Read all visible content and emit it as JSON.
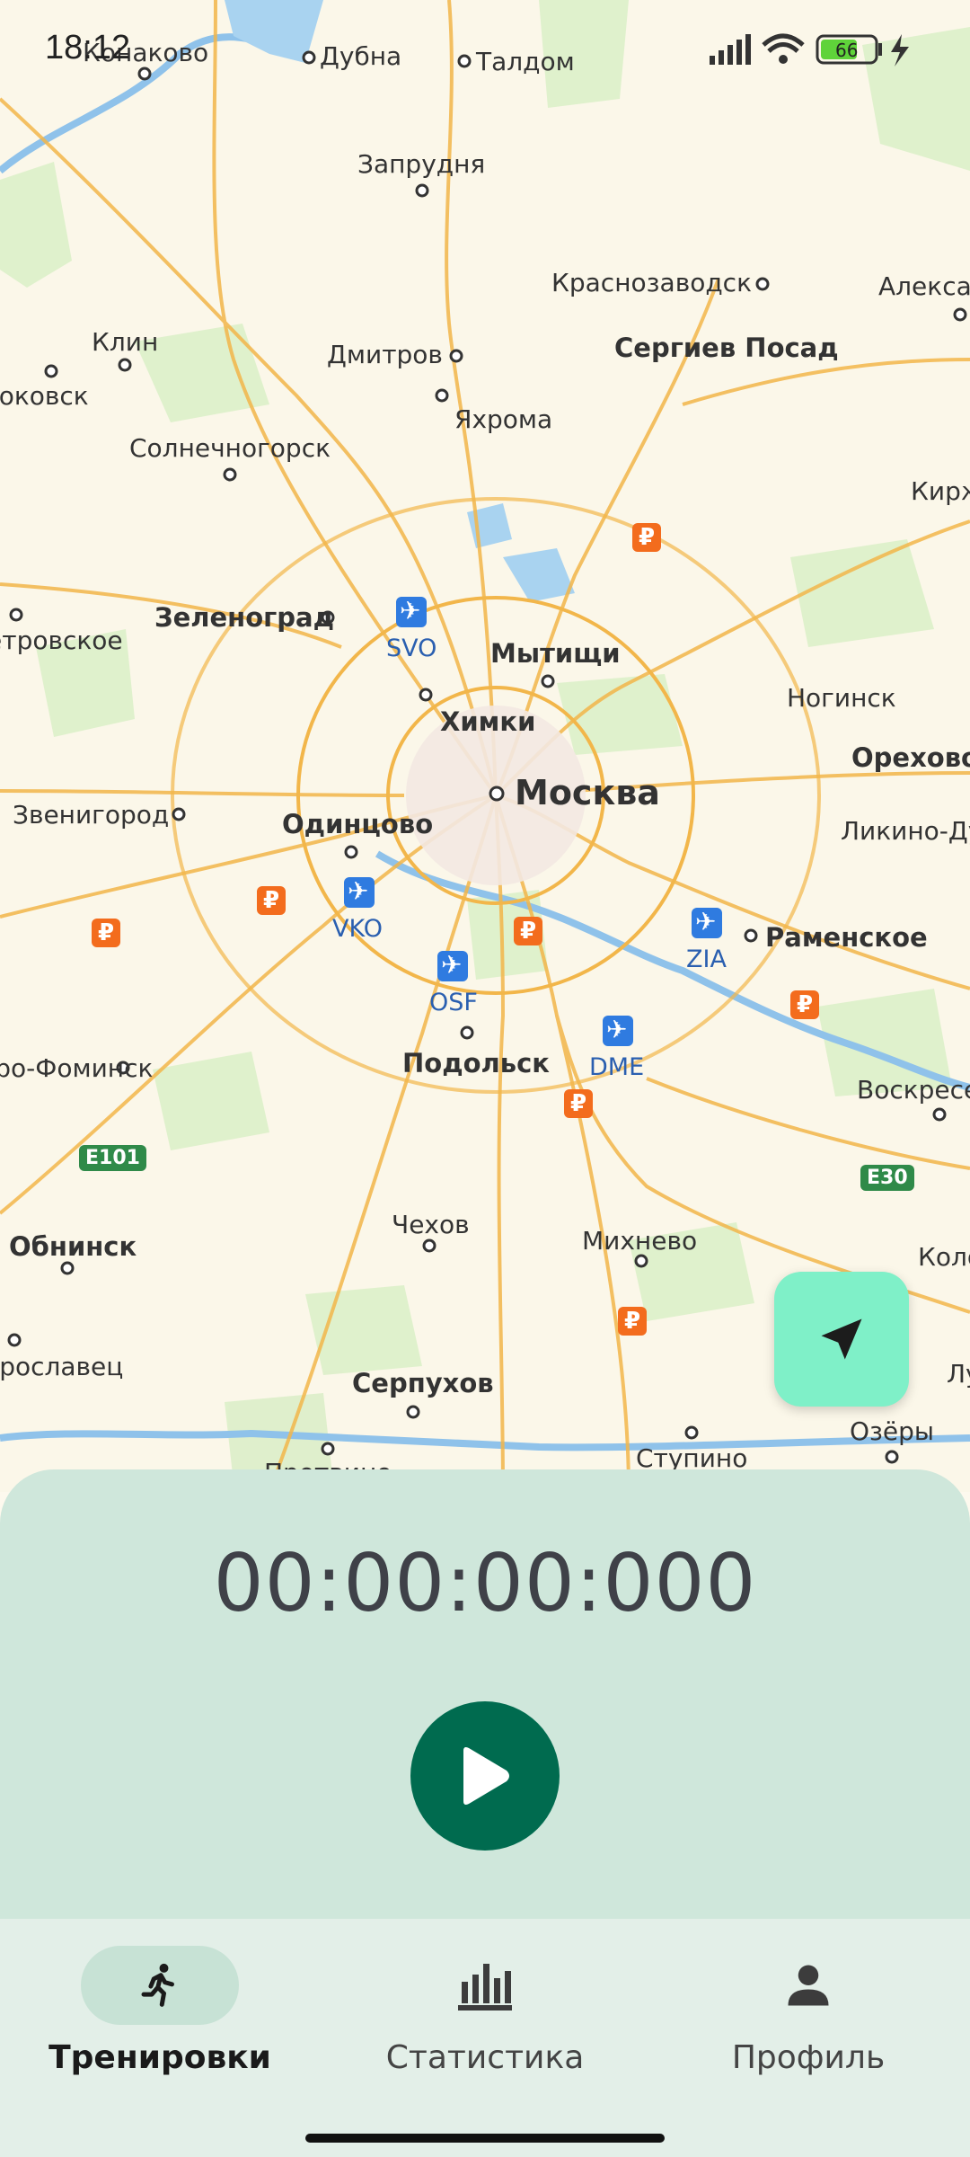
{
  "status_bar": {
    "time": "18:12",
    "battery": "66"
  },
  "map": {
    "cities": [
      {
        "name": "Конаково",
        "cls": "small"
      },
      {
        "name": "Дубна",
        "cls": "small"
      },
      {
        "name": "Талдом",
        "cls": "small"
      },
      {
        "name": "Запрудня",
        "cls": "small"
      },
      {
        "name": "Краснозаводск",
        "cls": "small"
      },
      {
        "name": "Александров",
        "cls": "small"
      },
      {
        "name": "Клин",
        "cls": "small"
      },
      {
        "name": "Дмитров",
        "cls": "small"
      },
      {
        "name": "Сергиев Посад",
        "cls": "mid"
      },
      {
        "name": "Высоковск",
        "cls": "small"
      },
      {
        "name": "Яхрома",
        "cls": "small"
      },
      {
        "name": "Солнечногорск",
        "cls": "small"
      },
      {
        "name": "Киржач",
        "cls": "small"
      },
      {
        "name": "Зеленоград",
        "cls": "mid"
      },
      {
        "name": "Петровское",
        "cls": "small"
      },
      {
        "name": "Мытищи",
        "cls": "mid"
      },
      {
        "name": "Химки",
        "cls": "mid"
      },
      {
        "name": "Ногинск",
        "cls": "small"
      },
      {
        "name": "Москва",
        "cls": "big"
      },
      {
        "name": "Орехово-Зуево",
        "cls": "mid"
      },
      {
        "name": "Звенигород",
        "cls": "small"
      },
      {
        "name": "Одинцово",
        "cls": "mid"
      },
      {
        "name": "Ликино-Дулёво",
        "cls": "small"
      },
      {
        "name": "Раменское",
        "cls": "mid"
      },
      {
        "name": "Подольск",
        "cls": "mid"
      },
      {
        "name": "Наро-Фоминск",
        "cls": "small"
      },
      {
        "name": "Воскресенск",
        "cls": "small"
      },
      {
        "name": "Обнинск",
        "cls": "mid"
      },
      {
        "name": "Чехов",
        "cls": "small"
      },
      {
        "name": "Михнево",
        "cls": "small"
      },
      {
        "name": "Коломна",
        "cls": "small"
      },
      {
        "name": "Малоярославец",
        "cls": "small"
      },
      {
        "name": "Серпухов",
        "cls": "mid"
      },
      {
        "name": "Луховицы",
        "cls": "small"
      },
      {
        "name": "Озёры",
        "cls": "small"
      },
      {
        "name": "Ступино",
        "cls": "small"
      },
      {
        "name": "Протвино",
        "cls": "small"
      }
    ],
    "airports": [
      "SVO",
      "VKO",
      "OSF",
      "DME",
      "ZIA"
    ],
    "road_shields": [
      "E101",
      "E30"
    ],
    "ruble_symbol": "₽"
  },
  "locate_button": {
    "icon": "navigation-arrow-icon"
  },
  "timer": {
    "value": "00:00:00:000"
  },
  "play_button": {
    "icon": "play-icon"
  },
  "nav": {
    "items": [
      {
        "label": "Тренировки",
        "icon": "running-person-icon",
        "active": true
      },
      {
        "label": "Статистика",
        "icon": "bar-chart-icon",
        "active": false
      },
      {
        "label": "Профиль",
        "icon": "person-icon",
        "active": false
      }
    ]
  },
  "colors": {
    "panel_bg": "#cfe7db",
    "accent_green": "#006b4f",
    "locate_bg": "#7ff0c8",
    "nav_bg": "#e3efe8"
  }
}
